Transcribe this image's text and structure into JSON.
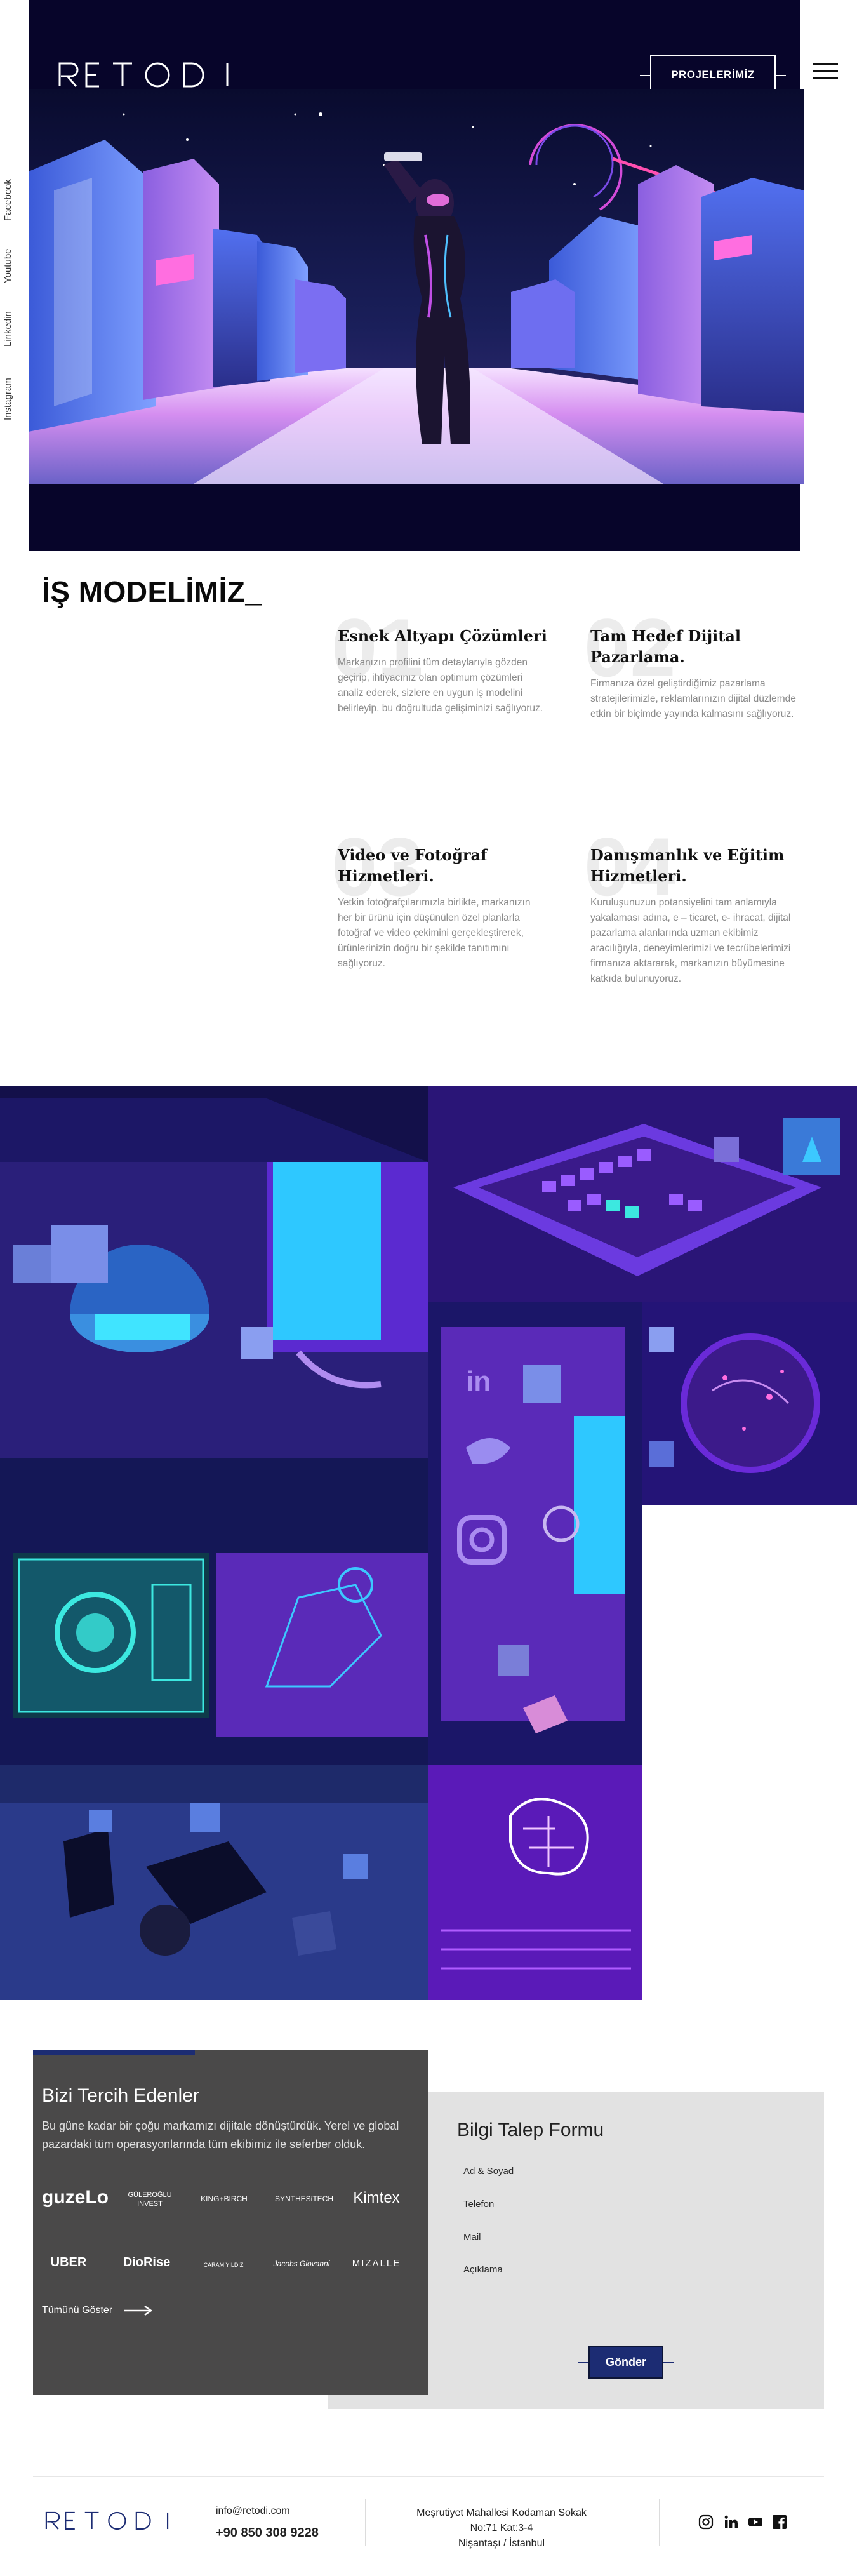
{
  "header": {
    "logo_text": "RETODI",
    "projects_button": "PROJELERİMİZ",
    "accent": "#1c2c73",
    "hero_bg": "#07052a"
  },
  "social": {
    "facebook": "Facebook",
    "youtube": "Youtube",
    "linkedin": "Linkedin",
    "instagram": "Instagram"
  },
  "business_model": {
    "title": "İŞ MODELİMİZ_",
    "items": [
      {
        "number": "01",
        "title": "Esnek Altyapı Çözümleri",
        "text": "Markanızın profilini tüm detaylarıyla gözden geçirip, ihtiyacınız olan optimum çözümleri analiz ederek, sizlere en uygun iş modelini belirleyip, bu doğrultuda gelişiminizi sağlıyoruz."
      },
      {
        "number": "02",
        "title": "Tam Hedef Dijital Pazarlama.",
        "text": "Firmanıza özel geliştirdiğimiz pazarlama stratejilerimizle, reklamlarınızın dijital düzlemde etkin bir biçimde yayında kalmasını sağlıyoruz."
      },
      {
        "number": "03",
        "title": "Video ve Fotoğraf Hizmetleri.",
        "text": "Yetkin fotoğrafçılarımızla birlikte, markanızın her bir ürünü için düşünülen özel planlarla fotoğraf ve video çekimini gerçekleştirerek, ürünlerinizin doğru bir şekilde tanıtımını sağlıyoruz."
      },
      {
        "number": "04",
        "title": "Danışmanlık ve Eğitim Hizmetleri.",
        "text": "Kuruluşunuzun potansiyelini tam anlamıyla yakalaması adına, e – ticaret, e- ihracat, dijital pazarlama alanlarında uzman ekibimiz aracılığıyla, deneyimlerimizi ve tecrübelerimizi firmanıza aktararak, markanızın büyümesine katkıda bulunuyoruz."
      }
    ]
  },
  "preferred": {
    "title": "Bizi Tercih Edenler",
    "description": "Bu güne kadar bir çoğu markamızı dijitale dönüştürdük. Yerel ve global pazardaki tüm operasyonlarında tüm ekibimiz ile seferber olduk.",
    "brands": [
      "guzeLo",
      "GÜLEROĞLU INVEST",
      "KING+BIRCH",
      "SYNTHESiTECH",
      "Kimtex",
      "UBER",
      "DioRise",
      "CARAM YILDIZ",
      "Jacobs Giovanni",
      "MIZALLE"
    ],
    "see_all": "Tümünü Göster"
  },
  "form": {
    "title": "Bilgi Talep Formu",
    "name_placeholder": "Ad & Soyad",
    "phone_placeholder": "Telefon",
    "mail_placeholder": "Mail",
    "description_placeholder": "Açıklama",
    "submit": "Gönder"
  },
  "footer": {
    "logo_text": "RETODI",
    "email": "info@retodi.com",
    "phone": "+90 850 308 9228",
    "address_line1": "Meşrutiyet Mahallesi Kodaman Sokak",
    "address_line2": "No:71 Kat:3-4",
    "address_line3": "Nişantaşı / İstanbul",
    "social_icons": [
      "instagram-icon",
      "linkedin-icon",
      "youtube-icon",
      "facebook-icon"
    ]
  }
}
